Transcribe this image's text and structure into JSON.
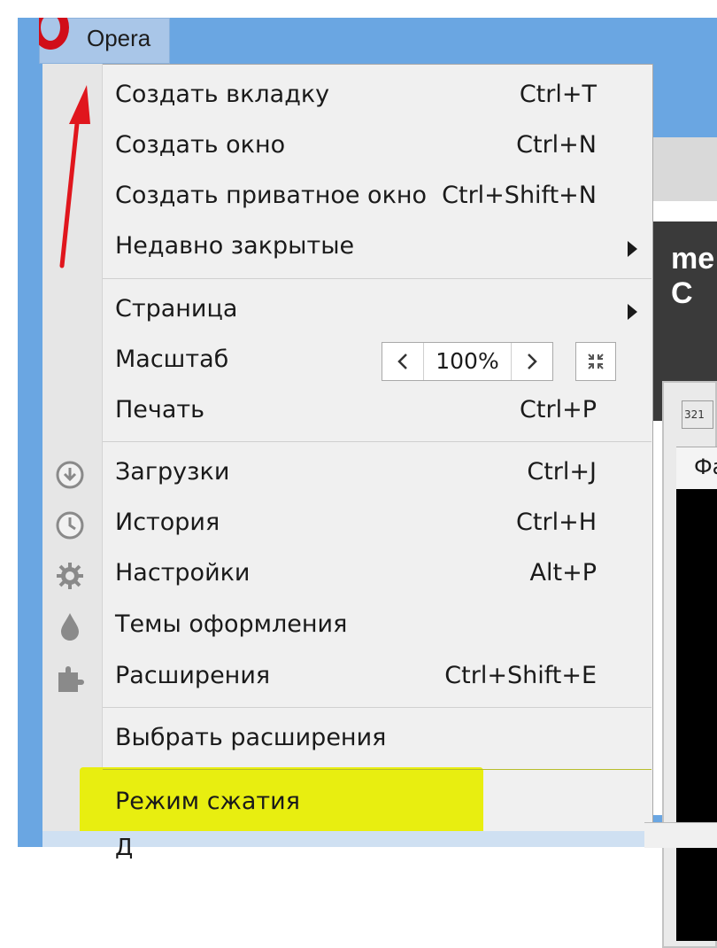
{
  "titlebar": {
    "app_label": "Opera"
  },
  "menu": {
    "groups": [
      [
        {
          "label": "Создать вкладку",
          "shortcut": "Ctrl+T"
        },
        {
          "label": "Создать окно",
          "shortcut": "Ctrl+N"
        },
        {
          "label": "Создать приватное окно",
          "shortcut": "Ctrl+Shift+N"
        },
        {
          "label": "Недавно закрытые",
          "submenu": true
        }
      ],
      [
        {
          "label": "Страница",
          "submenu": true
        },
        {
          "label": "Масштаб",
          "zoom": "100%"
        },
        {
          "label": "Печать",
          "shortcut": "Ctrl+P"
        }
      ],
      [
        {
          "label": "Загрузки",
          "shortcut": "Ctrl+J",
          "icon": "download-icon"
        },
        {
          "label": "История",
          "shortcut": "Ctrl+H",
          "icon": "clock-icon"
        },
        {
          "label": "Настройки",
          "shortcut": "Alt+P",
          "icon": "gear-icon"
        },
        {
          "label": "Темы оформления",
          "icon": "drop-icon"
        },
        {
          "label": "Расширения",
          "shortcut": "Ctrl+Shift+E",
          "icon": "puzzle-icon"
        }
      ],
      [
        {
          "label": "Выбрать расширения"
        }
      ],
      [
        {
          "label": "Режим сжатия"
        }
      ]
    ],
    "bottom_partial": "Д"
  },
  "background": {
    "banner_fragment": "me C",
    "app_icon_number": "321",
    "column_header_fragment": "Фа"
  },
  "colors": {
    "highlight": "#e8ee10",
    "annotation_arrow": "#e0161d",
    "opera_red": "#d10d19",
    "desktop_blue": "#6aa6e2"
  }
}
